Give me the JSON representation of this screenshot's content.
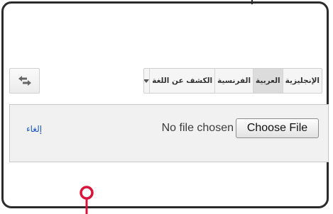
{
  "language_bar": {
    "languages": [
      "الإنجليزية",
      "العربية",
      "الفرنسية",
      "الكشف عن اللغة"
    ],
    "selected_index": 1,
    "dropdown_icon": "chevron-down-icon"
  },
  "swap_button": {
    "icon": "swap-arrows-icon"
  },
  "file_panel": {
    "choose_label": "Choose File",
    "status": "No file chosen",
    "cancel_label": "إلغاء"
  },
  "colors": {
    "link": "#1a56c2",
    "pin": "#d9143a",
    "frame": "#2b2b2b"
  }
}
